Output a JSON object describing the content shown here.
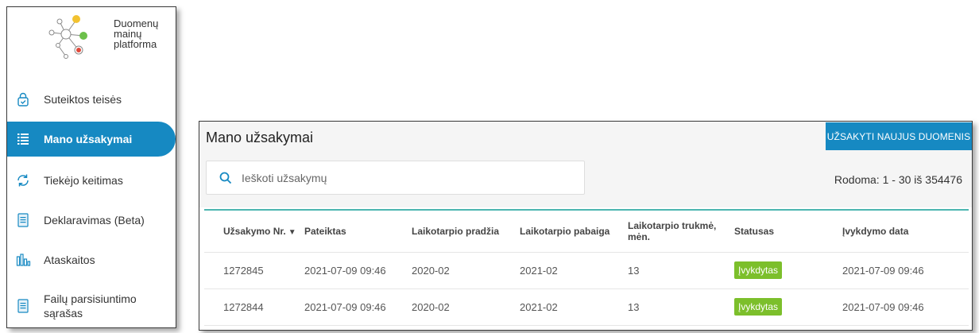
{
  "sidebar": {
    "logo_lines": [
      "Duomenų",
      "mainų",
      "platforma"
    ],
    "items": [
      {
        "label": "Suteiktos teisės",
        "icon": "lock-check-icon"
      },
      {
        "label": "Mano užsakymai",
        "icon": "list-icon",
        "active": true
      },
      {
        "label": "Tiekėjo keitimas",
        "icon": "refresh-icon"
      },
      {
        "label": "Deklaravimas (Beta)",
        "icon": "document-icon"
      },
      {
        "label": "Ataskaitos",
        "icon": "bar-chart-icon"
      },
      {
        "label_line1": "Failų parsisiuntimo",
        "label_line2": "sąrašas",
        "icon": "document-icon"
      }
    ]
  },
  "orders": {
    "title": "Mano užsakymai",
    "order_button": "UŽSAKYTI NAUJUS DUOMENIS",
    "search_placeholder": "Ieškoti užsakymų",
    "count_text": "Rodoma: 1 - 30 iš 354476",
    "columns": {
      "order_no": "Užsakymo Nr.",
      "submitted": "Pateiktas",
      "period_start": "Laikotarpio pradžia",
      "period_end": "Laikotarpio pabaiga",
      "duration_line1": "Laikotarpio trukmė,",
      "duration_line2": "mėn.",
      "status": "Statusas",
      "fulfilled_date": "Įvykdymo data"
    },
    "rows": [
      {
        "order_no": "1272845",
        "submitted": "2021-07-09 09:46",
        "period_start": "2020-02",
        "period_end": "2021-02",
        "duration": "13",
        "status": "Įvykdytas",
        "fulfilled_date": "2021-07-09 09:46"
      },
      {
        "order_no": "1272844",
        "submitted": "2021-07-09 09:46",
        "period_start": "2020-02",
        "period_end": "2021-02",
        "duration": "13",
        "status": "Įvykdytas",
        "fulfilled_date": "2021-07-09 09:46"
      }
    ]
  },
  "colors": {
    "accent": "#1689c2",
    "status_green": "#7cbf2b",
    "table_top_border": "#4cb6b0",
    "logo_yellow": "#f2c230",
    "logo_green": "#6cc04a",
    "logo_red": "#e0483a"
  }
}
